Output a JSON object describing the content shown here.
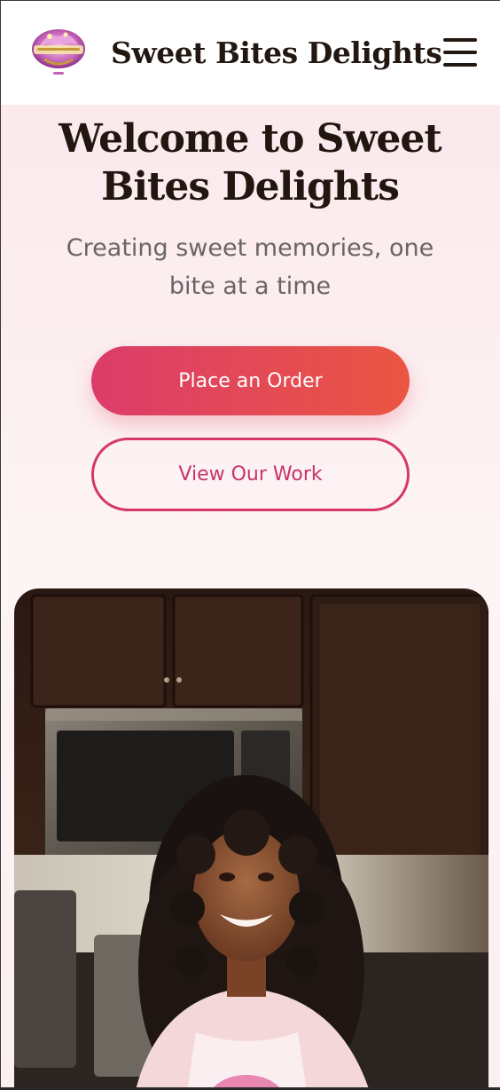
{
  "header": {
    "brand": "Sweet Bites Delights",
    "logo_icon": "sweet-bites-logo-icon",
    "menu_icon": "hamburger-menu-icon"
  },
  "hero": {
    "title": "Welcome to Sweet Bites Delights",
    "subtitle": "Creating sweet memories, one bite at a time",
    "primary_button": "Place an Order",
    "secondary_button": "View Our Work"
  },
  "photo": {
    "subject": "baker-portrait-photo"
  },
  "colors": {
    "accent_pink": "#d6386a",
    "accent_orange": "#ea5642",
    "text_dark": "#231712",
    "text_muted": "#6a6565",
    "hero_bg": "#fbe9ec"
  }
}
